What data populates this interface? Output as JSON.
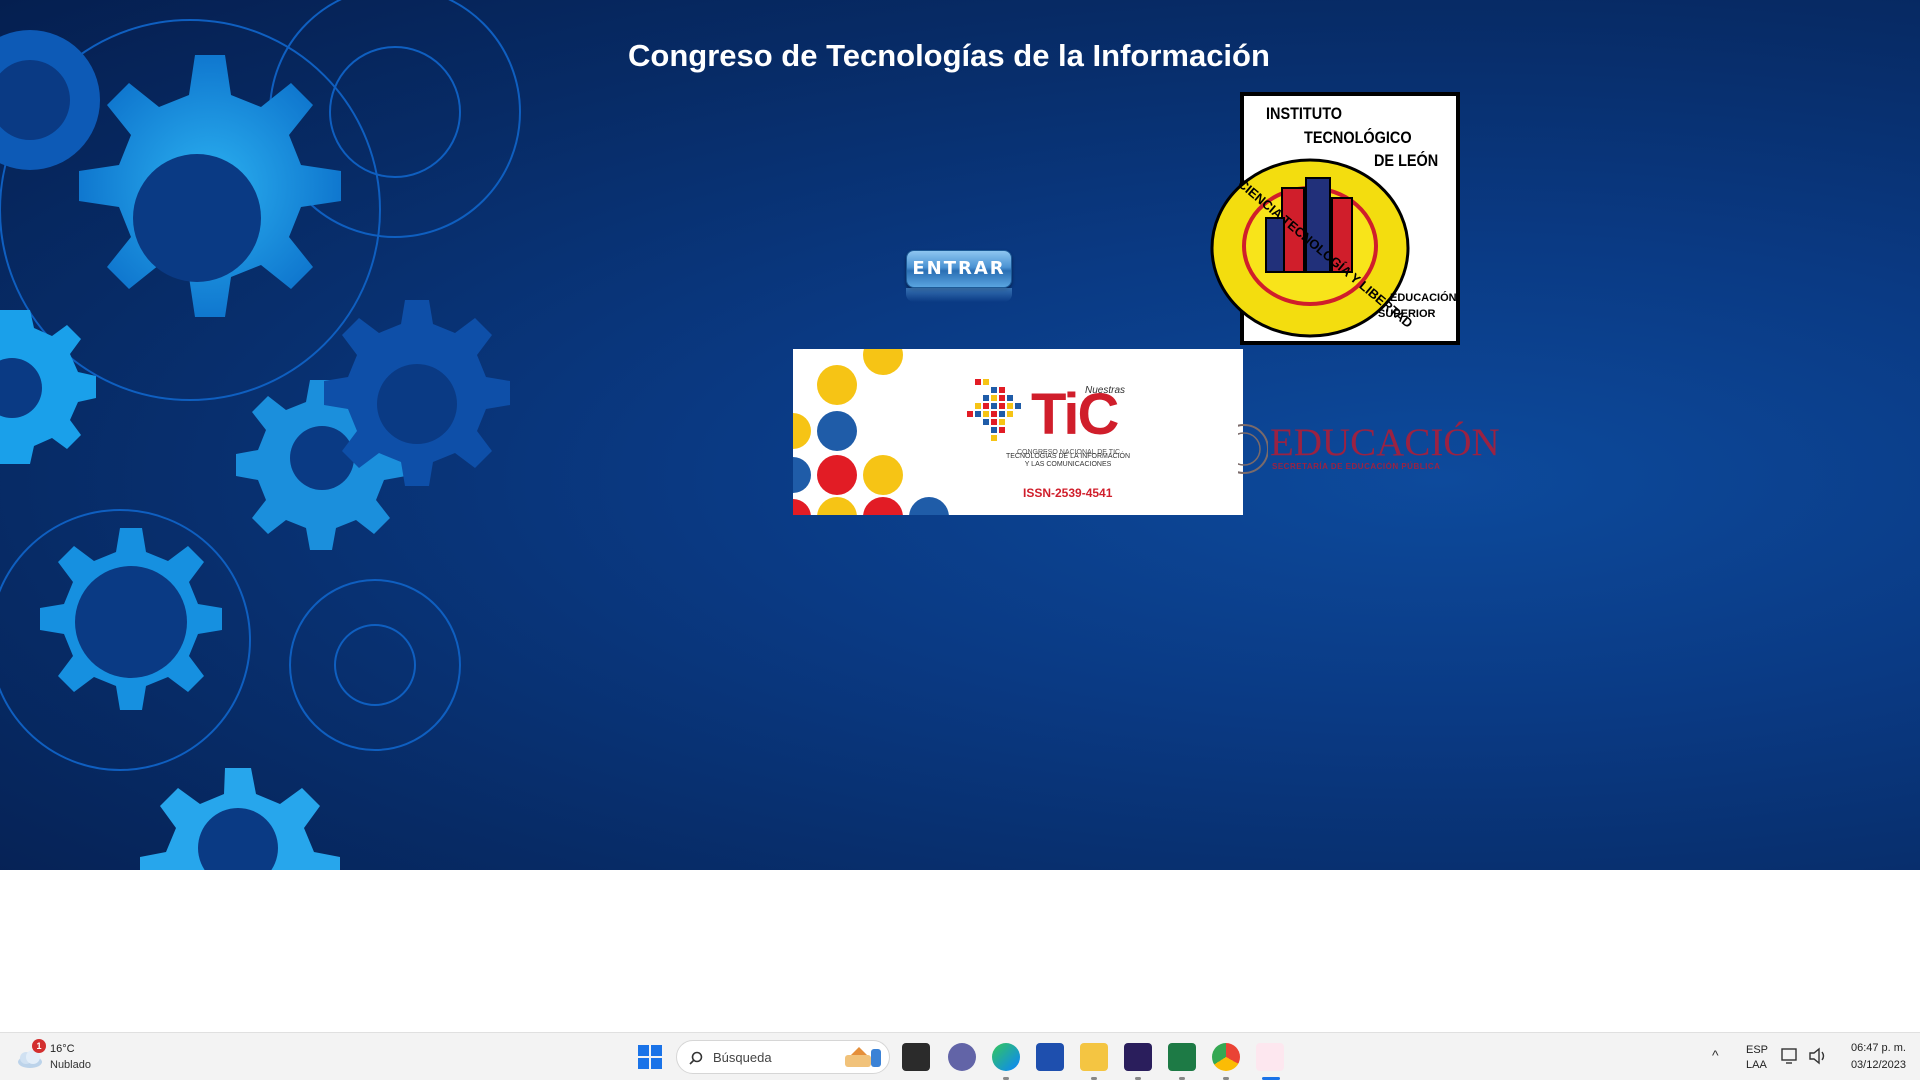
{
  "page": {
    "title": "Congreso de Tecnologías de la Información",
    "enter_label": "ENTRAR"
  },
  "itl_logo": {
    "line1": "INSTITUTO",
    "line2": "TECNOLÓGICO",
    "line3": "DE LEÓN",
    "motto": "CIENCIA TECNOLOGÍA Y LIBERTAD",
    "badge1": "EDUCACIÓN",
    "badge2": "SUPERIOR",
    "letters": "ITL"
  },
  "tic_banner": {
    "nuestras": "Nuestras",
    "word": "TiC",
    "congreso": "CONGRESO NACIONAL DE TIC",
    "caption1": "TECNOLOGÍAS DE LA INFORMACIÓN",
    "caption2": "Y LAS COMUNICACIONES",
    "issn": "ISSN-2539-4541"
  },
  "edu_logo": {
    "word": "EDUCACIÓN",
    "sub": "SECRETARÍA DE EDUCACIÓN PÚBLICA"
  },
  "taskbar": {
    "weather_temp": "16°C",
    "weather_desc": "Nublado",
    "weather_badge": "1",
    "search_placeholder": "Búsqueda",
    "lang1": "ESP",
    "lang2": "LAA",
    "time": "06:47 p. m.",
    "date": "03/12/2023",
    "apps": [
      "file-explorer-icon",
      "teams-icon",
      "edge-icon",
      "store-icon",
      "folder-icon",
      "media-icon",
      "excel-icon",
      "chrome-icon",
      "snipping-tool-icon"
    ]
  },
  "colors": {
    "background": "#0a3a84",
    "title": "#ffffff",
    "tic_red": "#d01e2b",
    "edu_maroon": "#9b2242"
  }
}
